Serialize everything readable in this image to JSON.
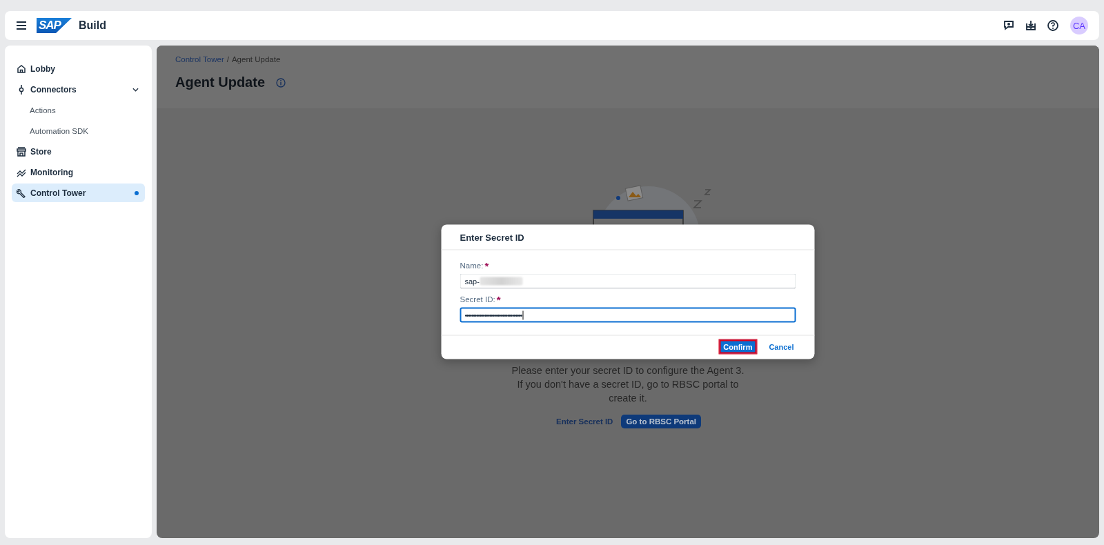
{
  "top_bar": {
    "brand": "SAP",
    "product": "Build",
    "avatar": "CA"
  },
  "sidebar": {
    "items": [
      {
        "label": "Lobby",
        "selected": false
      },
      {
        "label": "Connectors",
        "selected": false,
        "expanded": true,
        "children": [
          {
            "label": "Actions",
            "selected": false
          },
          {
            "label": "Automation SDK",
            "selected": false
          }
        ]
      },
      {
        "label": "Store",
        "selected": false
      },
      {
        "label": "Monitoring",
        "selected": false
      },
      {
        "label": "Control Tower",
        "selected": true
      }
    ]
  },
  "page": {
    "breadcrumb": [
      {
        "label": "Control Tower",
        "kind": "link"
      },
      {
        "label": "Agent Update",
        "kind": "current"
      }
    ],
    "breadcrumb_separator": "/",
    "title": "Agent Update",
    "message": "Please enter your secret ID to configure the Agent 3. If you don't have a secret ID, go to RBSC portal to create it.",
    "actions": [
      {
        "label": "Enter Secret ID",
        "kind": "link"
      },
      {
        "label": "Go to RBSC Portal",
        "kind": "primary"
      }
    ]
  },
  "dialog": {
    "title": "Enter Secret ID",
    "fields": [
      {
        "label": "Name:",
        "required_mark": "*",
        "value": "sap-",
        "redacted": true,
        "focused": false
      },
      {
        "label": "Secret ID:",
        "required_mark": "*",
        "value": "•••••••••••••••••••••••••••••••••••",
        "redacted": false,
        "focused": true
      }
    ],
    "buttons": [
      {
        "label": "Confirm",
        "kind": "primary",
        "highlighted": true
      },
      {
        "label": "Cancel",
        "kind": "link",
        "highlighted": false
      }
    ]
  }
}
